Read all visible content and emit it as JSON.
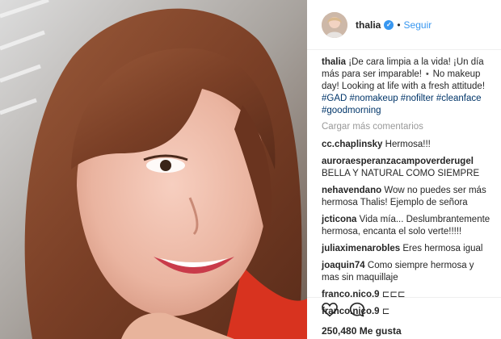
{
  "post": {
    "author": "thalia",
    "follow_label": "Seguir",
    "separator": "•",
    "caption": {
      "user": "thalia",
      "text": "¡De cara limpia a la vida! ¡Un día más para ser imparable! ⋆ No makeup day! Looking at life with a fresh attitude!",
      "hashtags": "#GAD #nomakeup #nofilter #cleanface #goodmorning"
    },
    "load_more_label": "Cargar más comentarios",
    "comments": [
      {
        "user": "cc.chaplinsky",
        "text": "Hermosa!!!"
      },
      {
        "user": "auroraesperanzacampoverderugel",
        "text": "BELLA Y NATURAL COMO SIEMPRE"
      },
      {
        "user": "nehavendano",
        "text": "Wow no puedes ser más hermosa Thalis! Ejemplo de señora"
      },
      {
        "user": "jcticona",
        "text": "Vida mía... Deslumbrantemente hermosa, encanta el solo verte!!!!!"
      },
      {
        "user": "juliaximenarobles",
        "text": "Eres hermosa igual"
      },
      {
        "user": "joaquin74",
        "text": "Como siempre hermosa y mas sin maquillaje"
      },
      {
        "user": "franco.nico.9",
        "text": "⊏⊏⊏"
      },
      {
        "user": "franco.nico.9",
        "text": "⊏"
      }
    ],
    "likes": "250,480 Me gusta",
    "icons": {
      "like": "heart-icon",
      "comment": "comment-icon",
      "verified": "verified-badge-icon"
    },
    "colors": {
      "link": "#3897f0",
      "hashtag": "#003569",
      "muted": "#999999"
    }
  }
}
